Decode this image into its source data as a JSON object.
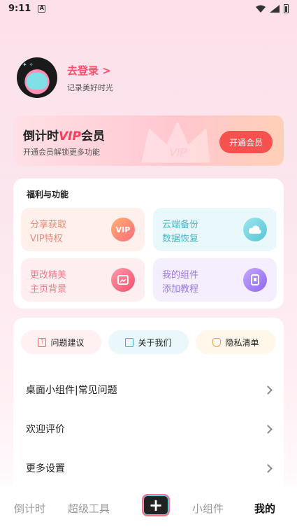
{
  "status": {
    "time": "9:11",
    "notif_glyph": "A"
  },
  "profile": {
    "login_label": "去登录 >",
    "subtitle": "记录美好时光"
  },
  "vip": {
    "title_prefix": "倒计时",
    "title_vip": "VIP",
    "title_suffix": "会员",
    "desc": "开通会员解锁更多功能",
    "button": "开通会员"
  },
  "welfare": {
    "heading": "福利与功能",
    "tiles": [
      {
        "line1": "分享获取",
        "line2": "VIP特权",
        "icon": "vip-crown-icon",
        "icon_text": "VIP"
      },
      {
        "line1": "云端备份",
        "line2": "数据恢复",
        "icon": "cloud-icon",
        "icon_text": ""
      },
      {
        "line1": "更改精美",
        "line2": "主页背景",
        "icon": "picture-icon",
        "icon_text": ""
      },
      {
        "line1": "我的组件",
        "line2": "添加教程",
        "icon": "phone-widget-icon",
        "icon_text": ""
      }
    ]
  },
  "links": {
    "pills": [
      {
        "label": "问题建议",
        "icon": "question-doc-icon",
        "glyph": "?"
      },
      {
        "label": "关于我们",
        "icon": "document-icon",
        "glyph": "≡"
      },
      {
        "label": "隐私清单",
        "icon": "shield-icon",
        "glyph": "✓"
      }
    ],
    "rows": [
      {
        "label": "桌面小组件|常见问题"
      },
      {
        "label": "欢迎评价"
      },
      {
        "label": "更多设置"
      }
    ]
  },
  "tabbar": {
    "tabs": [
      "倒计时",
      "超级工具",
      "小组件",
      "我的"
    ],
    "plus_glyph": "+",
    "active": "我的"
  },
  "colors": {
    "accent": "#f6504f",
    "brand_pink": "#ff4d6d",
    "vip_red": "#ff3b5c"
  }
}
